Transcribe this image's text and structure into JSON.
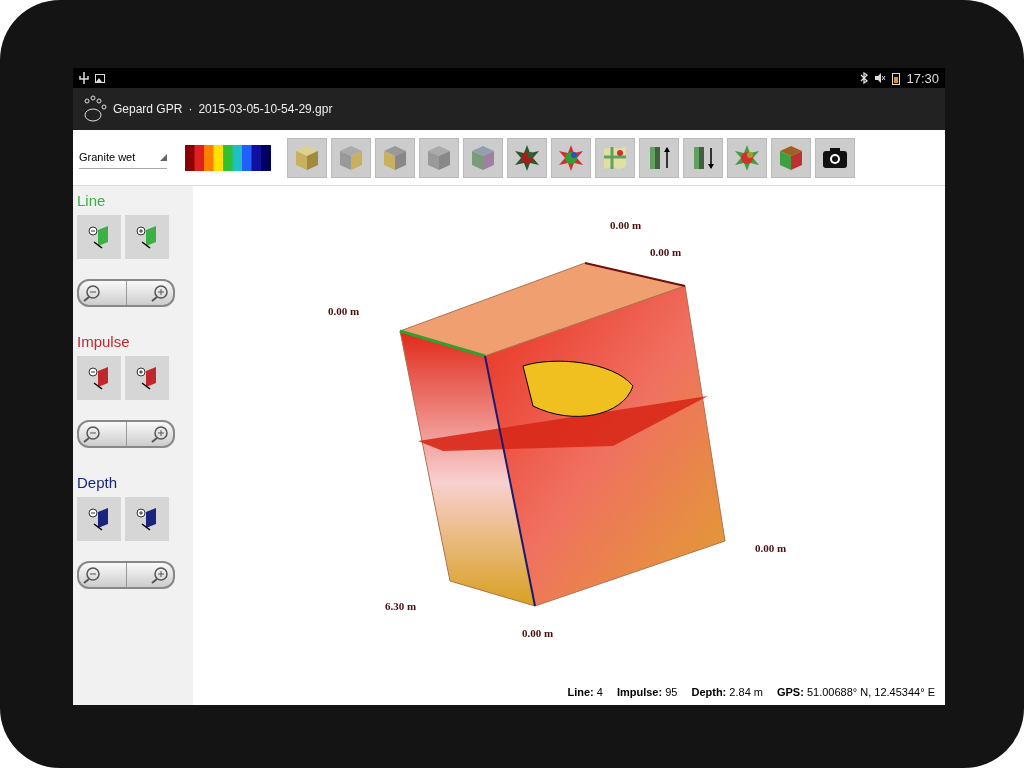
{
  "status_bar": {
    "time": "17:30"
  },
  "app_bar": {
    "title": "Gepard GPR",
    "separator": "·",
    "file": "2015-03-05-10-54-29.gpr"
  },
  "toolbar": {
    "material": "Granite wet"
  },
  "sidebar": [
    {
      "title": "Line",
      "color": "#3cb043"
    },
    {
      "title": "Impulse",
      "color": "#c0282d"
    },
    {
      "title": "Depth",
      "color": "#1a237e"
    }
  ],
  "view_labels": [
    "0.00 m",
    "0.00 m",
    "0.00 m",
    "0.00 m",
    "6.30 m",
    "0.00 m"
  ],
  "info_line": [
    {
      "label": "Line:",
      "value": "4"
    },
    {
      "label": "Impulse:",
      "value": "95"
    },
    {
      "label": "Depth:",
      "value": "2.84 m"
    },
    {
      "label": "GPS:",
      "value": "51.00688° N, 12.45344° E"
    }
  ]
}
